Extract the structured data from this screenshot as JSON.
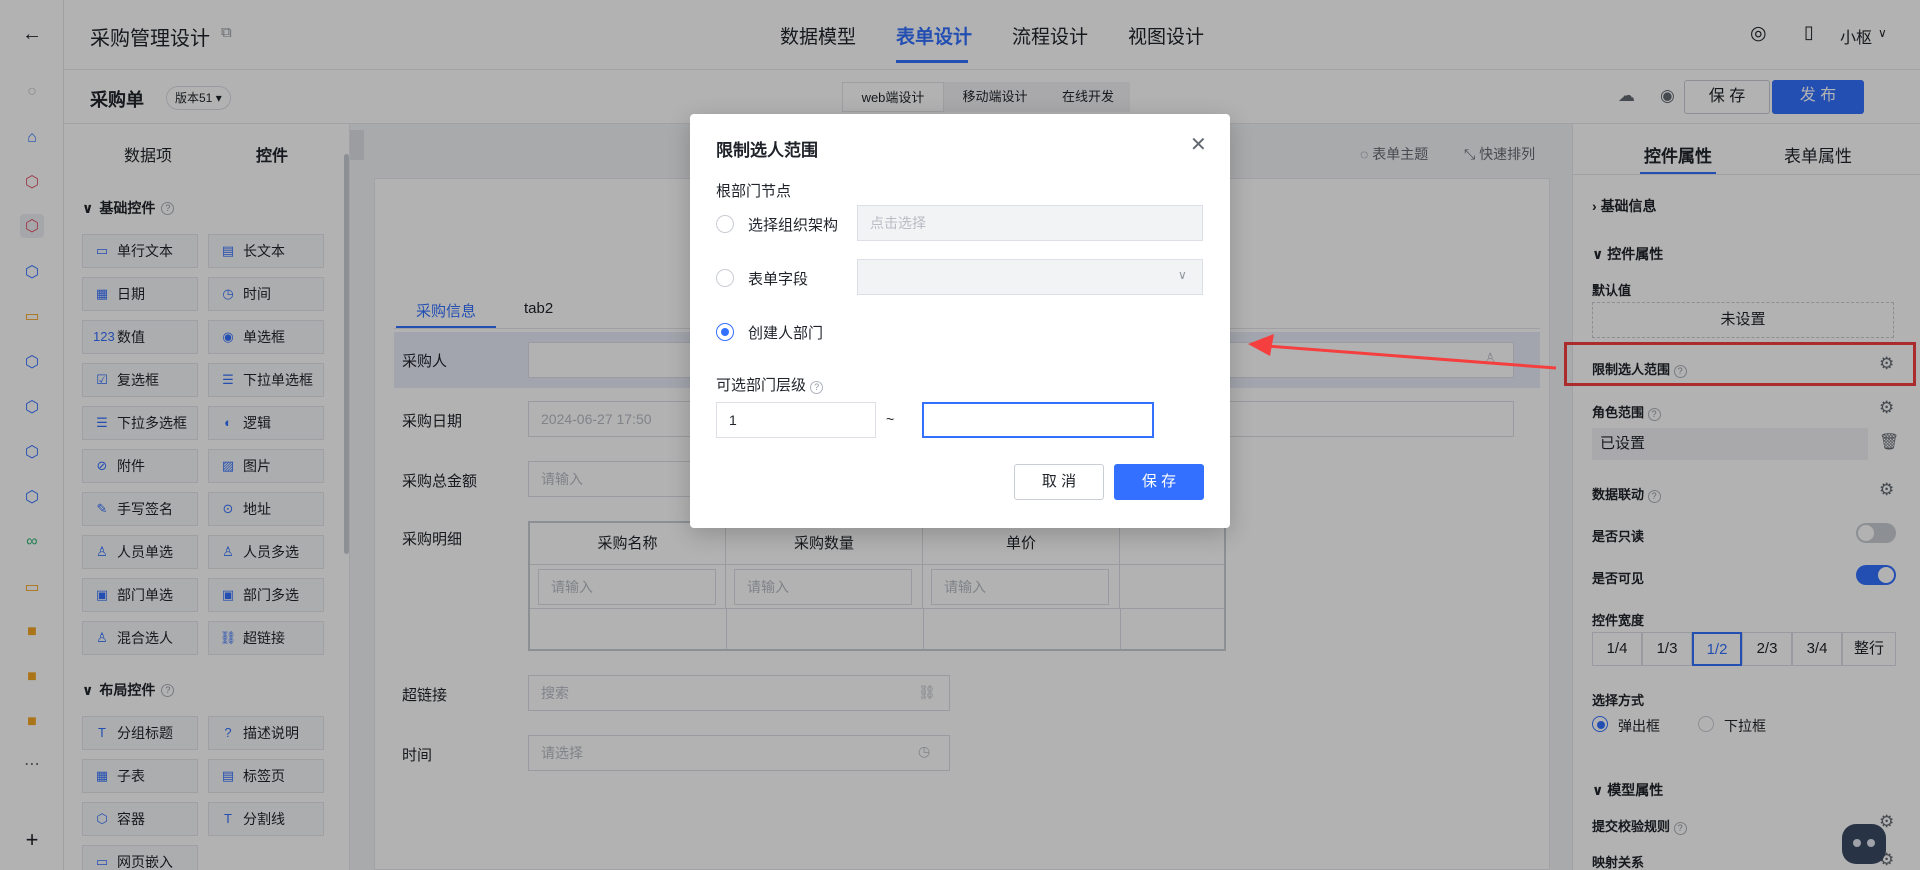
{
  "header": {
    "back_icon": "arrow-left-icon",
    "title": "采购管理设计",
    "tabs": [
      "数据模型",
      "表单设计",
      "流程设计",
      "视图设计"
    ],
    "active_tab": "表单设计",
    "user": "小枢"
  },
  "subbar": {
    "form_name": "采购单",
    "version": "版本51",
    "modes": [
      "web端设计",
      "移动端设计",
      "在线开发"
    ],
    "save_label": "保 存",
    "publish_label": "发 布"
  },
  "left_panel": {
    "tabs": [
      "数据项",
      "控件"
    ],
    "active_tab": "控件",
    "basic_title": "基础控件",
    "basic_controls": [
      {
        "label": "单行文本",
        "icon": "▭"
      },
      {
        "label": "长文本",
        "icon": "▤"
      },
      {
        "label": "日期",
        "icon": "▦"
      },
      {
        "label": "时间",
        "icon": "◷"
      },
      {
        "label": "数值",
        "icon": "123"
      },
      {
        "label": "单选框",
        "icon": "◉"
      },
      {
        "label": "复选框",
        "icon": "☑"
      },
      {
        "label": "下拉单选框",
        "icon": "☰"
      },
      {
        "label": "下拉多选框",
        "icon": "☰"
      },
      {
        "label": "逻辑",
        "icon": "◐"
      },
      {
        "label": "附件",
        "icon": "⊘"
      },
      {
        "label": "图片",
        "icon": "▨"
      },
      {
        "label": "手写签名",
        "icon": "✎"
      },
      {
        "label": "地址",
        "icon": "⊙"
      },
      {
        "label": "人员单选",
        "icon": "♙"
      },
      {
        "label": "人员多选",
        "icon": "♙"
      },
      {
        "label": "部门单选",
        "icon": "▣"
      },
      {
        "label": "部门多选",
        "icon": "▣"
      },
      {
        "label": "混合选人",
        "icon": "♙"
      },
      {
        "label": "超链接",
        "icon": "⛓"
      }
    ],
    "layout_title": "布局控件",
    "layout_controls": [
      {
        "label": "分组标题",
        "icon": "T"
      },
      {
        "label": "描述说明",
        "icon": "?"
      },
      {
        "label": "子表",
        "icon": "▦"
      },
      {
        "label": "标签页",
        "icon": "▤"
      },
      {
        "label": "容器",
        "icon": "⬡"
      },
      {
        "label": "分割线",
        "icon": "T"
      },
      {
        "label": "网页嵌入",
        "icon": "▭"
      }
    ]
  },
  "canvas": {
    "toolbar": [
      "表单主题",
      "快速排列"
    ],
    "tabs": [
      "采购信息",
      "tab2"
    ],
    "fields": {
      "purchaser": "采购人",
      "date_label": "采购日期",
      "date_value": "2024-06-27 17:50",
      "amount_label": "采购总金额",
      "amount_placeholder": "请输入",
      "detail_label": "采购明细",
      "table_headers": [
        "采购名称",
        "采购数量",
        "单价"
      ],
      "table_placeholder": "请输入",
      "link_label": "超链接",
      "link_placeholder": "搜索",
      "time_label": "时间",
      "time_placeholder": "请选择"
    }
  },
  "right_panel": {
    "tabs": [
      "控件属性",
      "表单属性"
    ],
    "active_tab": "控件属性",
    "basic_info": "基础信息",
    "control_props": "控件属性",
    "default_label": "默认值",
    "default_value": "未设置",
    "limit_label": "限制选人范围",
    "role_label": "角色范围",
    "role_value": "已设置",
    "linkage_label": "数据联动",
    "readonly_label": "是否只读",
    "readonly": false,
    "visible_label": "是否可见",
    "visible": true,
    "width_label": "控件宽度",
    "width_options": [
      "1/4",
      "1/3",
      "1/2",
      "2/3",
      "3/4",
      "整行"
    ],
    "width_selected": "1/2",
    "select_label": "选择方式",
    "select_options": [
      "弹出框",
      "下拉框"
    ],
    "select_selected": "弹出框",
    "model_props": "模型属性",
    "rule_label": "提交校验规则",
    "mapping_label": "映射关系"
  },
  "dialog": {
    "title": "限制选人范围",
    "root_label": "根部门节点",
    "options": [
      "选择组织架构",
      "表单字段",
      "创建人部门"
    ],
    "selected_option": "创建人部门",
    "org_placeholder": "点击选择",
    "level_label": "可选部门层级",
    "level_from": "1",
    "level_sep": "~",
    "level_to": "",
    "cancel_label": "取 消",
    "save_label": "保 存"
  },
  "colors": {
    "primary": "#3370ff",
    "annotation": "#f53f3f"
  }
}
